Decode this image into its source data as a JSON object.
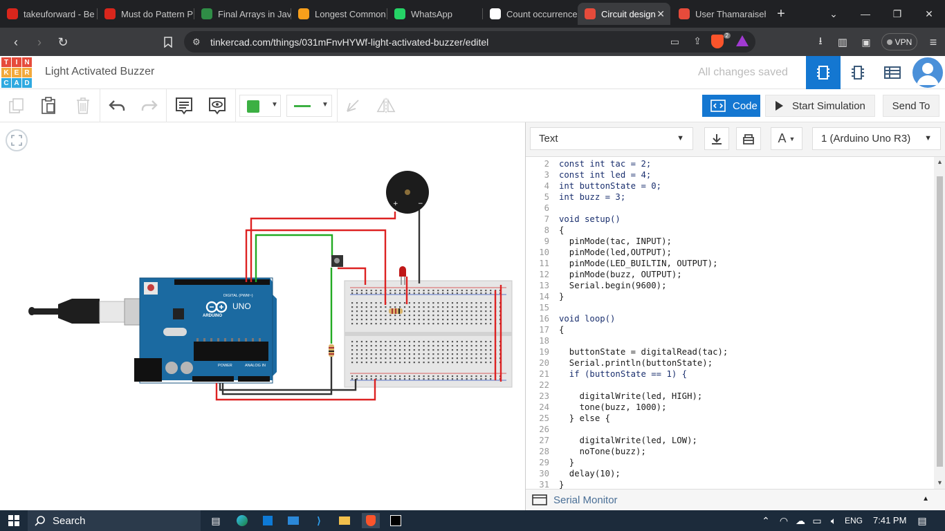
{
  "browser": {
    "tabs": [
      {
        "label": "takeuforward - Be",
        "icon": "tuf-icon",
        "color": "#d9261c"
      },
      {
        "label": "Must do Pattern P",
        "icon": "tuf-icon",
        "color": "#d9261c"
      },
      {
        "label": "Final Arrays in Jav",
        "icon": "gfg-icon",
        "color": "#2f8d46"
      },
      {
        "label": "Longest Common",
        "icon": "leetcode-icon",
        "color": "#f89f1b"
      },
      {
        "label": "WhatsApp",
        "icon": "whatsapp-icon",
        "color": "#25d366"
      },
      {
        "label": "Count occurrence",
        "icon": "chatgpt-icon",
        "color": "#ffffff"
      },
      {
        "label": "Circuit design",
        "icon": "tinkercad-icon",
        "color": "#e64b3b"
      },
      {
        "label": "User Thamaraiseh",
        "icon": "tinkercad-icon",
        "color": "#e64b3b"
      }
    ],
    "url": "tinkercad.com/things/031mFnvHYWf-light-activated-buzzer/editel",
    "vpn_label": "VPN",
    "brave_badge": "2"
  },
  "header": {
    "logo_letters": [
      "T",
      "I",
      "N",
      "K",
      "E",
      "R",
      "C",
      "A",
      "D"
    ],
    "title": "Light Activated Buzzer",
    "save_status": "All changes saved"
  },
  "toolbar": {
    "code_label": "Code",
    "start_sim_label": "Start Simulation",
    "send_to_label": "Send To",
    "wire_color": "#3cb043"
  },
  "code_panel": {
    "mode": "Text",
    "device": "1 (Arduino Uno R3)",
    "serial_monitor_label": "Serial Monitor",
    "lines": [
      {
        "n": "2",
        "code": "const int tac = 2;"
      },
      {
        "n": "3",
        "code": "const int led = 4;"
      },
      {
        "n": "4",
        "code": "int buttonState = 0;"
      },
      {
        "n": "5",
        "code": "int buzz = 3;"
      },
      {
        "n": "6",
        "code": ""
      },
      {
        "n": "7",
        "code": "void setup()"
      },
      {
        "n": "8",
        "code": "{"
      },
      {
        "n": "9",
        "code": "  pinMode(tac, INPUT);"
      },
      {
        "n": "10",
        "code": "  pinMode(led,OUTPUT);"
      },
      {
        "n": "11",
        "code": "  pinMode(LED_BUILTIN, OUTPUT);"
      },
      {
        "n": "12",
        "code": "  pinMode(buzz, OUTPUT);"
      },
      {
        "n": "13",
        "code": "  Serial.begin(9600);"
      },
      {
        "n": "14",
        "code": "}"
      },
      {
        "n": "15",
        "code": ""
      },
      {
        "n": "16",
        "code": "void loop()"
      },
      {
        "n": "17",
        "code": "{"
      },
      {
        "n": "18",
        "code": ""
      },
      {
        "n": "19",
        "code": "  buttonState = digitalRead(tac);"
      },
      {
        "n": "20",
        "code": "  Serial.println(buttonState);"
      },
      {
        "n": "21",
        "code": "  if (buttonState == 1) {"
      },
      {
        "n": "22",
        "code": ""
      },
      {
        "n": "23",
        "code": "    digitalWrite(led, HIGH);"
      },
      {
        "n": "24",
        "code": "    tone(buzz, 1000);"
      },
      {
        "n": "25",
        "code": "  } else {"
      },
      {
        "n": "26",
        "code": ""
      },
      {
        "n": "27",
        "code": "    digitalWrite(led, LOW);"
      },
      {
        "n": "28",
        "code": "    noTone(buzz);"
      },
      {
        "n": "29",
        "code": "  }"
      },
      {
        "n": "30",
        "code": "  delay(10);"
      },
      {
        "n": "31",
        "code": "}"
      }
    ]
  },
  "circuit": {
    "board_brand": "ARDUINO",
    "board_model": "UNO",
    "digital_label": "DIGITAL (PWM~)",
    "power_label": "POWER",
    "analog_label": "ANALOG IN"
  },
  "taskbar": {
    "search_label": "Search",
    "language": "ENG",
    "time": "7:41 PM"
  }
}
